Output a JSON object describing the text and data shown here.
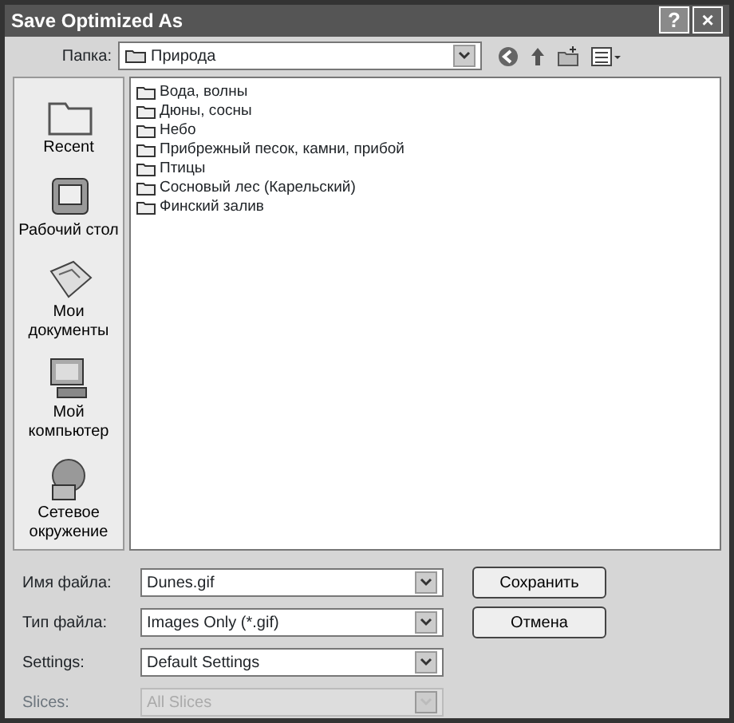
{
  "window": {
    "title": "Save Optimized As"
  },
  "title_buttons": [
    {
      "kind": "help",
      "label": "?"
    },
    {
      "kind": "close",
      "label": "×"
    }
  ],
  "folder": {
    "label": "Папка:",
    "value": "Природа"
  },
  "places": [
    {
      "kind": "recent",
      "label": "Recent"
    },
    {
      "kind": "desktop",
      "label": "Рабочий стол"
    },
    {
      "kind": "documents",
      "label": "Мои документы"
    },
    {
      "kind": "computer",
      "label": "Мой компьютер"
    },
    {
      "kind": "network",
      "label": "Сетевое окружение"
    }
  ],
  "files": [
    "Вода, волны",
    "Дюны, сосны",
    "Небо",
    "Прибрежный песок, камни, прибой",
    "Птицы",
    "Сосновый лес (Карельский)",
    "Финский залив"
  ],
  "fields": [
    {
      "label": "Имя файла:",
      "value": "Dunes.gif",
      "disabled": false,
      "button": "Сохранить"
    },
    {
      "label": "Тип файла:",
      "value": "Images Only (*.gif)",
      "disabled": false,
      "button": "Отмена"
    },
    {
      "label": "Settings:",
      "value": "Default Settings",
      "disabled": false
    },
    {
      "label": "Slices:",
      "value": "All Slices",
      "disabled": true
    }
  ]
}
